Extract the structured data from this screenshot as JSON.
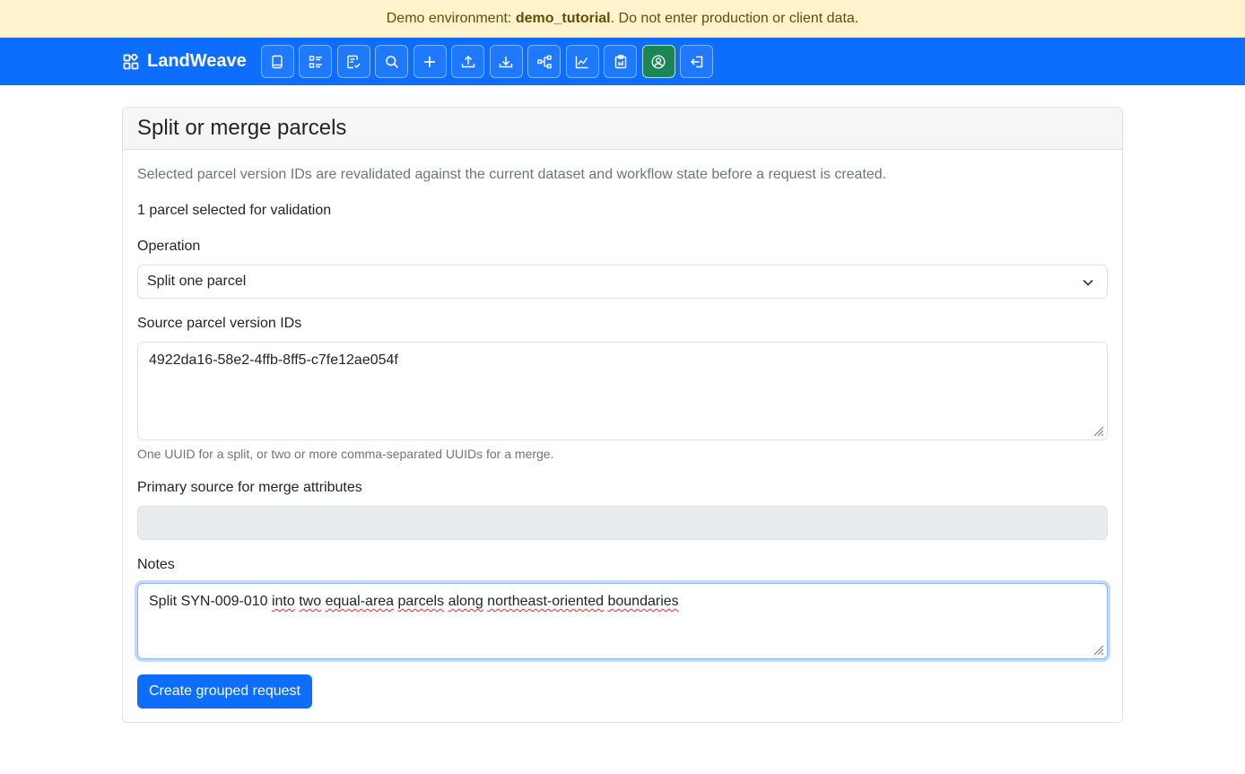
{
  "banner": {
    "prefix": "Demo environment: ",
    "env_name": "demo_tutorial",
    "suffix": ". Do not enter production or client data."
  },
  "navbar": {
    "brand": "LandWeave",
    "buttons": [
      {
        "icon": "book-icon"
      },
      {
        "icon": "list-icon"
      },
      {
        "icon": "review-icon"
      },
      {
        "icon": "search-icon"
      },
      {
        "icon": "plus-icon"
      },
      {
        "icon": "upload-icon"
      },
      {
        "icon": "download-icon"
      },
      {
        "icon": "diagram-icon"
      },
      {
        "icon": "chart-icon"
      },
      {
        "icon": "clipboard-icon"
      },
      {
        "icon": "user-circle-icon",
        "active": true
      },
      {
        "icon": "logout-icon"
      }
    ]
  },
  "colors": {
    "primary": "#0d6efd",
    "active_nav": "#198754",
    "banner_bg": "#fff3cd"
  },
  "card": {
    "title": "Split or merge parcels",
    "intro": "Selected parcel version IDs are revalidated against the current dataset and workflow state before a request is created.",
    "selection_count": "1 parcel selected for validation",
    "operation_label": "Operation",
    "operation_value": "Split one parcel",
    "source_label": "Source parcel version IDs",
    "source_value": "4922da16-58e2-4ffb-8ff5-c7fe12ae054f",
    "source_help": "One UUID for a split, or two or more comma-separated UUIDs for a merge.",
    "primary_label": "Primary source for merge attributes",
    "primary_value": "",
    "notes_label": "Notes",
    "notes_words": [
      "Split SYN-009-010 ",
      "into",
      " ",
      "two",
      " ",
      "equal-area",
      " ",
      "parcels",
      " ",
      "along",
      " ",
      "northeast-oriented",
      " ",
      "boundaries"
    ],
    "submit_label": "Create grouped request"
  }
}
